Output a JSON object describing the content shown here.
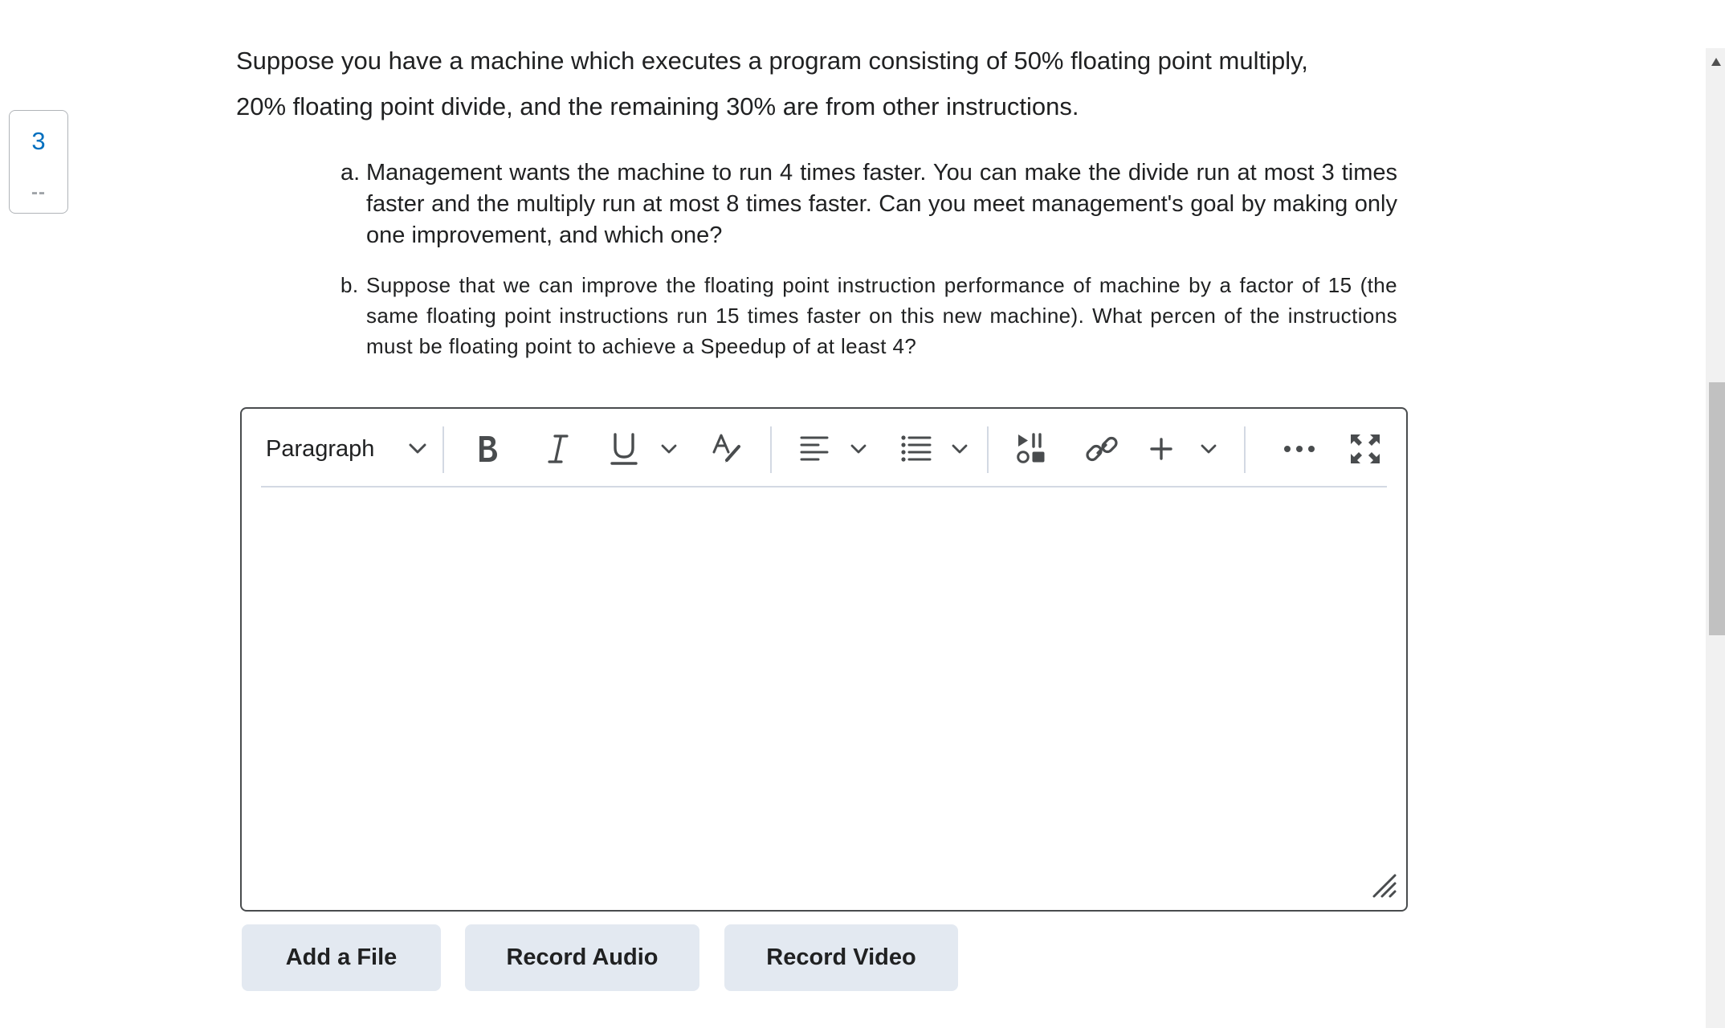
{
  "question": {
    "number": "3",
    "status": "--",
    "intro_line1": "Suppose you have a machine which executes a program consisting of 50% floating point multiply,",
    "intro_line2": "20% floating point divide, and the remaining 30% are from other instructions.",
    "parts": [
      {
        "marker": "a.",
        "text": "Management wants the machine to run 4 times faster. You can make the divide run at most 3 times faster and the multiply run at most 8 times faster. Can you meet management's goal by making only one improvement, and which one?"
      },
      {
        "marker": "b.",
        "text": "Suppose that we can improve the floating point instruction performance of machine by a factor of 15 (the same floating point instructions run 15 times faster on this new machine). What percen of the instructions must be floating point to achieve a Speedup of at least 4?"
      }
    ]
  },
  "editor": {
    "format": "Paragraph",
    "icons": {
      "format_dropdown": "chevron-down-icon",
      "bold": "bold-icon",
      "italic": "italic-icon",
      "underline": "underline-icon",
      "text_style": "text-style-icon",
      "align": "align-left-icon",
      "list": "bulleted-list-icon",
      "media": "insert-media-icon",
      "link": "link-icon",
      "insert": "plus-icon",
      "more": "more-options-icon",
      "fullscreen": "fullscreen-icon",
      "resize": "resize-handle-icon"
    },
    "content": ""
  },
  "actions": {
    "add_file": "Add a File",
    "record_audio": "Record Audio",
    "record_video": "Record Video"
  },
  "colors": {
    "accent": "#006fbf",
    "text": "#202122",
    "button_bg": "#e3e9f1",
    "editor_border": "#494c4e"
  }
}
